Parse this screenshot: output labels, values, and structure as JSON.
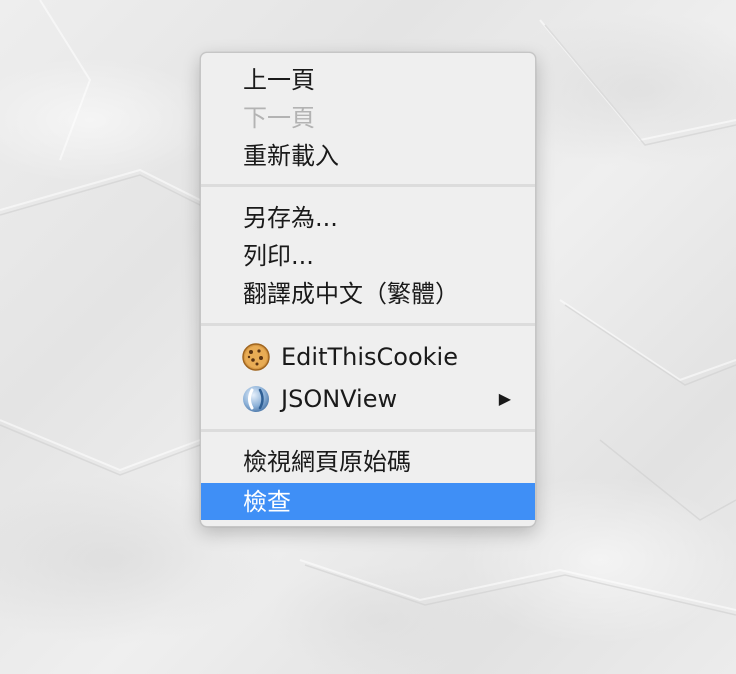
{
  "context_menu": {
    "group_navigation": {
      "back": "上一頁",
      "forward": "下一頁",
      "reload": "重新載入"
    },
    "group_page": {
      "save_as": "另存為...",
      "print": "列印...",
      "translate": "翻譯成中文（繁體）"
    },
    "group_extensions": {
      "editthiscookie": "EditThisCookie",
      "jsonview": "JSONView",
      "jsonview_submenu_arrow": "▶"
    },
    "group_developer": {
      "view_source": "檢視網頁原始碼",
      "inspect": "檢查"
    },
    "states": {
      "forward_disabled": true,
      "highlighted_item": "inspect"
    }
  },
  "colors": {
    "menu_background": "#efefef",
    "highlight": "#3f8ff6",
    "disabled_text": "#b3b3b3",
    "separator": "#dcdcdc"
  },
  "icons": {
    "editthiscookie": "cookie-icon",
    "jsonview": "jsonview-icon"
  }
}
